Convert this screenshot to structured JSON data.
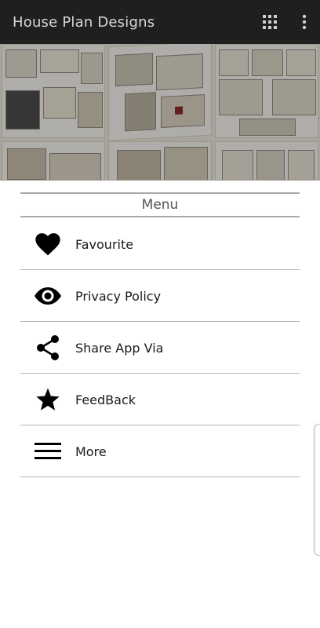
{
  "app_bar": {
    "title": "House Plan Designs",
    "grid_icon": "apps-grid-icon",
    "overflow_icon": "more-vert-icon",
    "background": "#1f1f1f"
  },
  "menu": {
    "header": "Menu",
    "items": [
      {
        "label": "Favourite",
        "icon": "heart-icon"
      },
      {
        "label": "Privacy Policy",
        "icon": "eye-icon"
      },
      {
        "label": "Share App Via",
        "icon": "share-icon"
      },
      {
        "label": "FeedBack",
        "icon": "star-icon"
      },
      {
        "label": "More",
        "icon": "hamburger-menu-icon"
      }
    ]
  }
}
